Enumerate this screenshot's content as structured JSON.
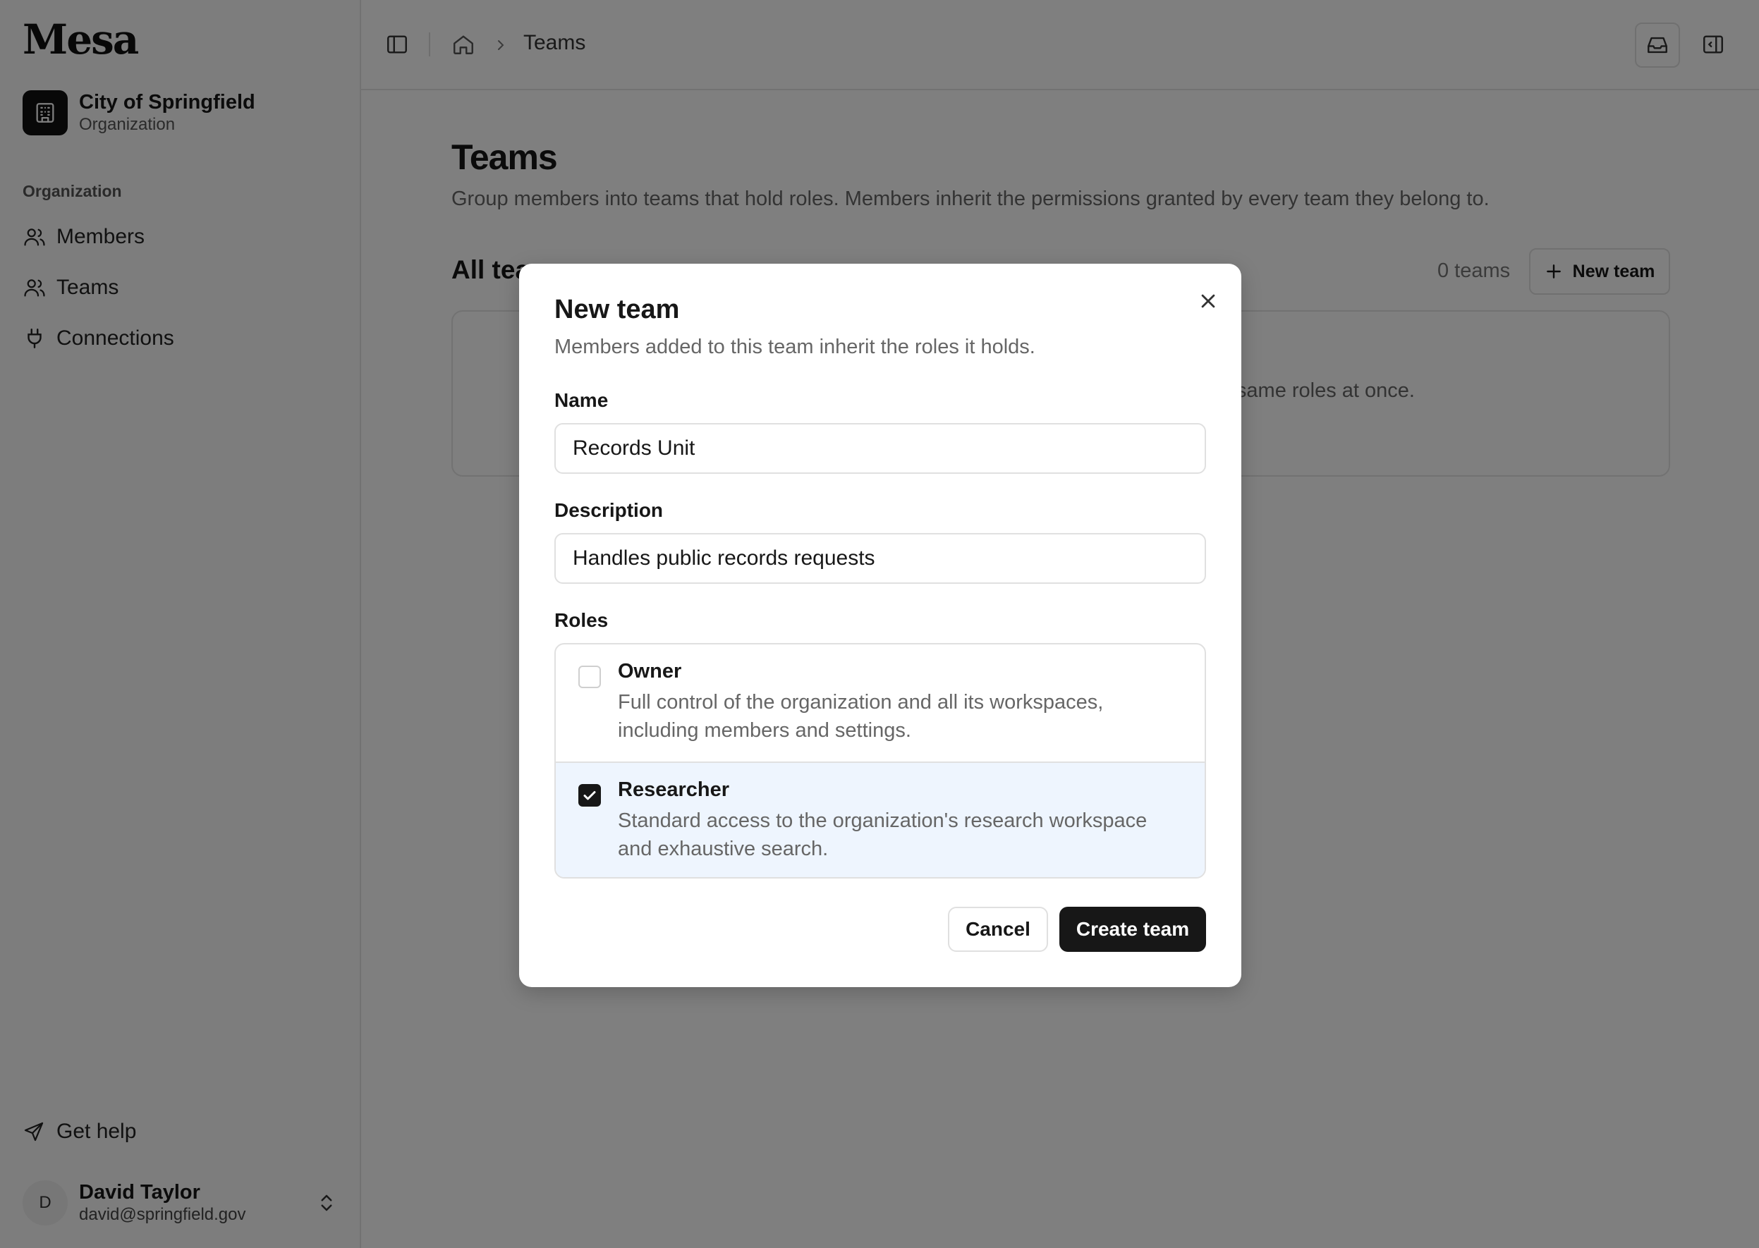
{
  "app": {
    "logo": "Mesa"
  },
  "org": {
    "name": "City of Springfield",
    "type": "Organization"
  },
  "sidebar": {
    "section_label": "Organization",
    "items": [
      {
        "label": "Members",
        "icon": "users-icon"
      },
      {
        "label": "Teams",
        "icon": "team-icon"
      },
      {
        "label": "Connections",
        "icon": "plug-icon"
      }
    ],
    "help_label": "Get help"
  },
  "user": {
    "initial": "D",
    "name": "David Taylor",
    "email": "david@springfield.gov"
  },
  "topbar": {
    "breadcrumb": "Teams"
  },
  "page": {
    "title": "Teams",
    "description": "Group members into teams that hold roles. Members inherit the permissions granted by every team they belong to.",
    "section_title": "All teams",
    "team_count": "0 teams",
    "new_team_label": "New team",
    "empty_text": "same roles at once."
  },
  "modal": {
    "title": "New team",
    "subtitle": "Members added to this team inherit the roles it holds.",
    "name_label": "Name",
    "name_value": "Records Unit",
    "description_label": "Description",
    "description_value": "Handles public records requests",
    "roles_label": "Roles",
    "roles": [
      {
        "name": "Owner",
        "description": "Full control of the organization and all its workspaces, including members and settings.",
        "checked": false
      },
      {
        "name": "Researcher",
        "description": "Standard access to the organization's research workspace and exhaustive search.",
        "checked": true
      }
    ],
    "cancel_label": "Cancel",
    "create_label": "Create team"
  },
  "colors": {
    "primary": "#171717",
    "selected_row": "#eef5fe",
    "overlay": "rgba(0,0,0,0.5)"
  }
}
